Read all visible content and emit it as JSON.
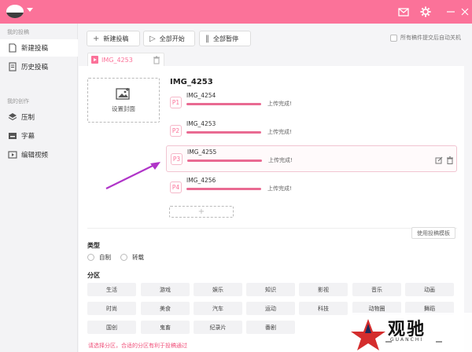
{
  "window": {
    "accent_color": "#fb7299"
  },
  "sidebar": {
    "group1_label": "我的投稿",
    "group2_label": "我的创作",
    "items": [
      {
        "label": "新建投稿",
        "icon": "file-icon",
        "active": true
      },
      {
        "label": "历史投稿",
        "icon": "document-icon",
        "active": false
      },
      {
        "label": "压制",
        "icon": "layers-icon",
        "active": false
      },
      {
        "label": "字幕",
        "icon": "subtitle-icon",
        "active": false
      },
      {
        "label": "编辑视频",
        "icon": "video-edit-icon",
        "active": false
      }
    ]
  },
  "toolbar": {
    "new_label": "新建投稿",
    "start_all_label": "全部开始",
    "pause_all_label": "全部暂停",
    "auto_shutdown_label": "所有稿件提交后自动关机"
  },
  "file_tab": {
    "name": "IMG_4253"
  },
  "cover": {
    "label": "设置封面"
  },
  "video": {
    "title": "IMG_4253",
    "parts": [
      {
        "badge": "P1",
        "name": "IMG_4254",
        "status": "上传完成!",
        "progress": 100,
        "selected": false
      },
      {
        "badge": "P2",
        "name": "IMG_4253",
        "status": "上传完成!",
        "progress": 100,
        "selected": false
      },
      {
        "badge": "P3",
        "name": "IMG_4255",
        "status": "上传完成!",
        "progress": 100,
        "selected": true
      },
      {
        "badge": "P4",
        "name": "IMG_4256",
        "status": "上传完成!",
        "progress": 100,
        "selected": false
      }
    ],
    "add_label": "+"
  },
  "template_button": "使用投稿模板",
  "type_section": {
    "heading": "类型",
    "options": [
      "自制",
      "转载"
    ]
  },
  "zone_section": {
    "heading": "分区",
    "rows": [
      [
        "生活",
        "游戏",
        "娱乐",
        "知识",
        "影视",
        "音乐",
        "动画"
      ],
      [
        "时尚",
        "美食",
        "汽车",
        "运动",
        "科技",
        "动物圈",
        "舞蹈"
      ],
      [
        "国创",
        "鬼畜",
        "纪录片",
        "番剧"
      ]
    ]
  },
  "hint": "请选择分区，合适的分区有利于投稿通过",
  "watermark": {
    "text": "观驰",
    "sub": "GUANCHI"
  }
}
